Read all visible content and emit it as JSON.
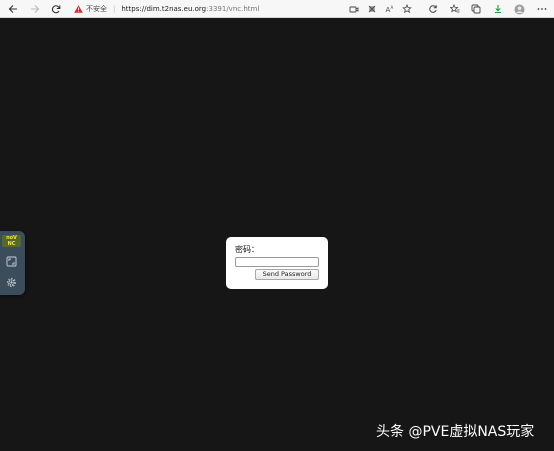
{
  "browser": {
    "security_label": "不安全",
    "url_host": "https://dim.t2nas.eu.org",
    "url_path": ":3391/vnc.html"
  },
  "dialog": {
    "password_label": "密码：",
    "password_value": "",
    "send_button_label": "Send Password"
  },
  "sidebar": {
    "logo_text_top": "noV",
    "logo_text_bottom": "NC"
  },
  "watermark": {
    "text": "头条 @PVE虚拟NAS玩家"
  },
  "colors": {
    "background": "#161616",
    "sidebar": "#3b4c5a",
    "warning": "#d32f2f"
  }
}
